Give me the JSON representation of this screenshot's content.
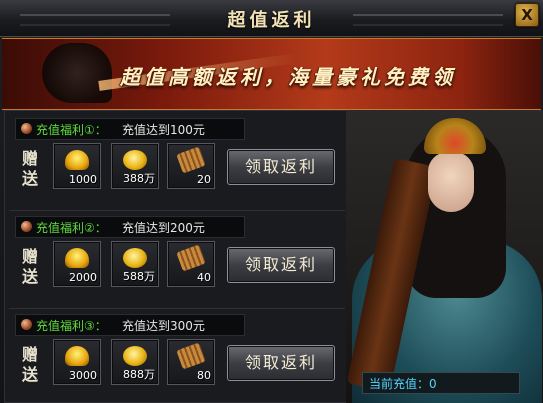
{
  "window": {
    "title": "超值返利",
    "close_label": "X"
  },
  "banner": {
    "slogan": "超值高额返利，海量豪礼免费领"
  },
  "gift_label": "赠送",
  "claim_label": "领取返利",
  "tiers": [
    {
      "label": "充值福利①：",
      "desc": "充值达到100元",
      "rewards": [
        {
          "icon": "gold-ingot-icon",
          "qty": "1000"
        },
        {
          "icon": "gold-coins-icon",
          "qty": "388万"
        },
        {
          "icon": "scroll-icon",
          "qty": "20"
        }
      ]
    },
    {
      "label": "充值福利②：",
      "desc": "充值达到200元",
      "rewards": [
        {
          "icon": "gold-ingot-icon",
          "qty": "2000"
        },
        {
          "icon": "gold-coins-icon",
          "qty": "588万"
        },
        {
          "icon": "scroll-icon",
          "qty": "40"
        }
      ]
    },
    {
      "label": "充值福利③：",
      "desc": "充值达到300元",
      "rewards": [
        {
          "icon": "gold-ingot-icon",
          "qty": "3000"
        },
        {
          "icon": "gold-coins-icon",
          "qty": "888万"
        },
        {
          "icon": "scroll-icon",
          "qty": "80"
        }
      ]
    }
  ],
  "current_recharge": {
    "label": "当前充值：",
    "value": "0"
  },
  "colors": {
    "accent_gold": "#f2e2b6",
    "tier_label": "#5fdc3c",
    "current_label": "#4fd6ff"
  }
}
